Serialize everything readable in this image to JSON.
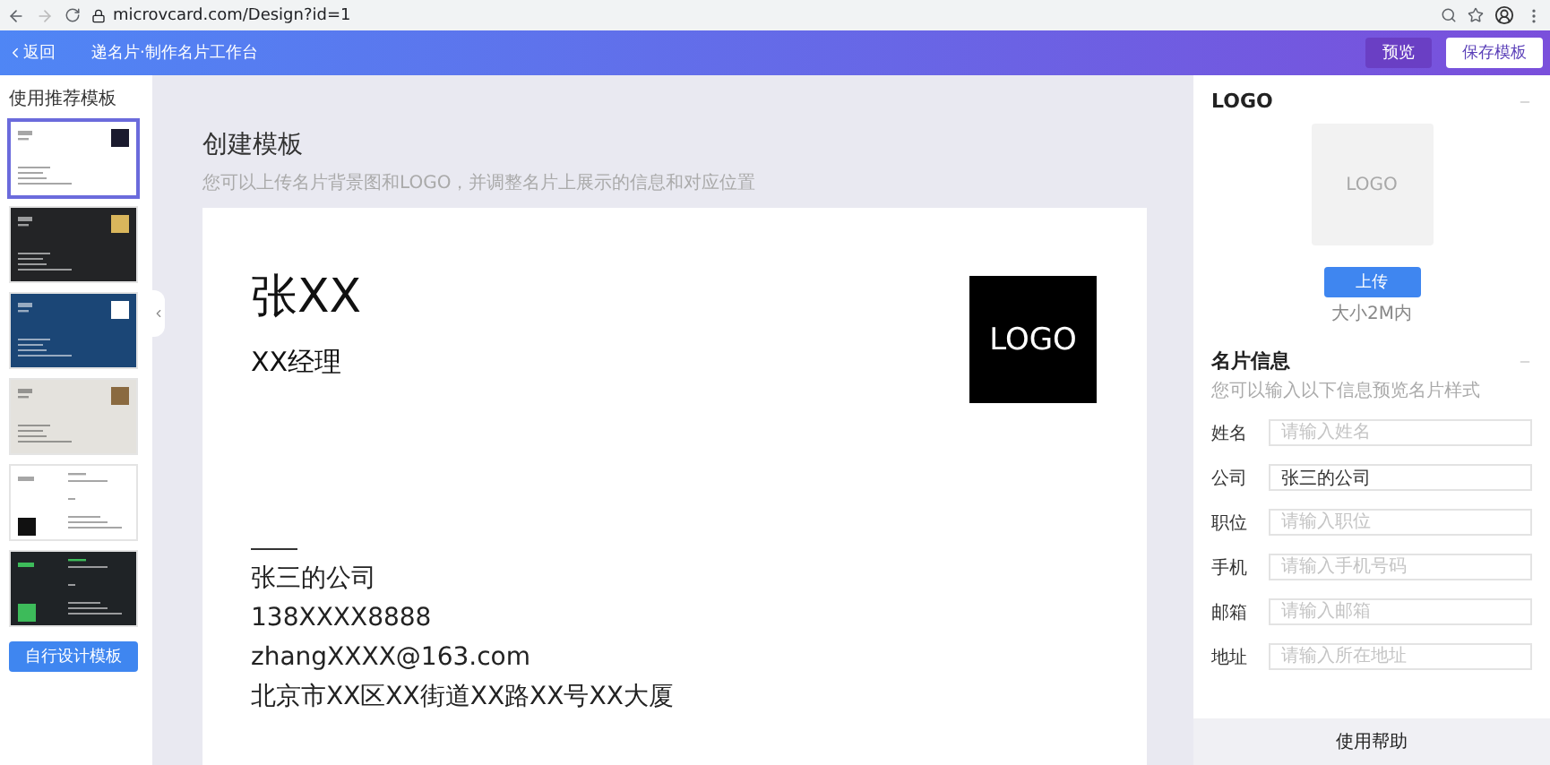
{
  "browser": {
    "url": "microvcard.com/Design?id=1"
  },
  "header": {
    "back": "返回",
    "title": "递名片·制作名片工作台",
    "buttons": [
      {
        "label": "预览",
        "kind": "secondary"
      },
      {
        "label": "保存模板",
        "kind": "primary"
      }
    ]
  },
  "sidebar": {
    "title": "使用推荐模板",
    "templates": [
      {
        "kind": "classic",
        "color": "#ffffff",
        "logo": {
          "color": "#1a1a2e"
        },
        "selected": true
      },
      {
        "kind": "classic",
        "color": "#232426",
        "logo": {
          "color": "#d9b65c"
        },
        "selected": false
      },
      {
        "kind": "classic",
        "color": "#1b4676",
        "logo": {
          "color": "#ffffff"
        },
        "selected": false
      },
      {
        "kind": "classic",
        "color": "#e4e2dd",
        "logo": {
          "color": "#8a6a40"
        },
        "selected": false
      },
      {
        "kind": "split",
        "color": "#ffffff",
        "logo": {
          "color": "#111111"
        },
        "selected": false
      },
      {
        "kind": "split",
        "color": "#1f2326",
        "logo": {
          "color": "#3dbb5a"
        },
        "selected": false
      }
    ],
    "button": "自行设计模板"
  },
  "main": {
    "title": "创建模板",
    "subtitle": "您可以上传名片背景图和LOGO，并调整名片上展示的信息和对应位置",
    "card": {
      "name": "张XX",
      "position": "XX经理",
      "logo": "LOGO",
      "company": "张三的公司",
      "phone": "138XXXX8888",
      "email": "zhangXXXX@163.com",
      "address": "北京市XX区XX街道XX路XX号XX大厦"
    }
  },
  "logo_section": {
    "title": "LOGO",
    "placeholder_logo": "LOGO",
    "upload": "上传",
    "hint": "大小2M内"
  },
  "info_section": {
    "title": "名片信息",
    "subtitle": "您可以输入以下信息预览名片样式",
    "fields": [
      {
        "label": "姓名",
        "placeholder": "请输入姓名"
      },
      {
        "label": "公司",
        "value": "张三的公司"
      },
      {
        "label": "职位",
        "placeholder": "请输入职位"
      },
      {
        "label": "手机",
        "placeholder": "请输入手机号码"
      },
      {
        "label": "邮箱",
        "placeholder": "请输入邮箱"
      },
      {
        "label": "地址",
        "placeholder": "请输入所在地址"
      }
    ]
  },
  "help": "使用帮助"
}
